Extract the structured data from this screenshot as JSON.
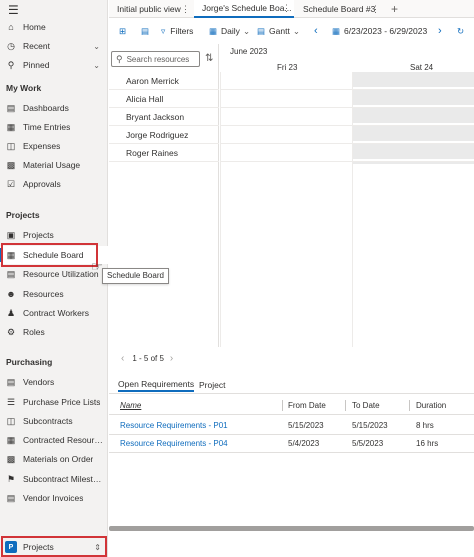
{
  "sidebar": {
    "top_items": [
      {
        "label": "Home",
        "icon": "home-icon"
      },
      {
        "label": "Recent",
        "icon": "clock-icon"
      },
      {
        "label": "Pinned",
        "icon": "pin-icon"
      }
    ],
    "sections": [
      {
        "title": "My Work",
        "items": [
          "Dashboards",
          "Time Entries",
          "Expenses",
          "Material Usage",
          "Approvals"
        ]
      },
      {
        "title": "Projects",
        "items": [
          "Projects",
          "Schedule Board",
          "Resource Utilization",
          "Resources",
          "Contract Workers",
          "Roles"
        ]
      },
      {
        "title": "Purchasing",
        "items": [
          "Vendors",
          "Purchase Price Lists",
          "Subcontracts",
          "Contracted Resource...",
          "Materials on Order",
          "Subcontract Mileston...",
          "Vendor Invoices"
        ]
      }
    ],
    "selected": "Schedule Board",
    "tooltip": "Schedule Board",
    "area_switcher": {
      "badge": "P",
      "label": "Projects"
    }
  },
  "tabs": [
    {
      "label": "Initial public view"
    },
    {
      "label": "Jorge's Schedule Boa..."
    },
    {
      "label": "Schedule Board #3"
    }
  ],
  "toolbar": {
    "filters": "Filters",
    "view": "Daily",
    "mode": "Gantt",
    "date_range": "6/23/2023 - 6/29/2023"
  },
  "resources": {
    "search_placeholder": "Search resources",
    "names": [
      "Aaron Merrick",
      "Alicia Hall",
      "Bryant Jackson",
      "Jorge Rodriguez",
      "Roger Raines"
    ],
    "pager": "1 - 5 of 5"
  },
  "timeline": {
    "month": "June 2023",
    "days": [
      "Fri 23",
      "Sat 24"
    ]
  },
  "requirements": {
    "tabs": [
      "Open Requirements",
      "Project"
    ],
    "columns": [
      "Name",
      "From Date",
      "To Date",
      "Duration"
    ],
    "rows": [
      {
        "name": "Resource Requirements - P01",
        "from": "5/15/2023",
        "to": "5/15/2023",
        "duration": "8 hrs"
      },
      {
        "name": "Resource Requirements - P04",
        "from": "5/4/2023",
        "to": "5/5/2023",
        "duration": "16 hrs"
      }
    ]
  },
  "colors": {
    "accent": "#0f6cbd",
    "highlight": "#d13438"
  }
}
